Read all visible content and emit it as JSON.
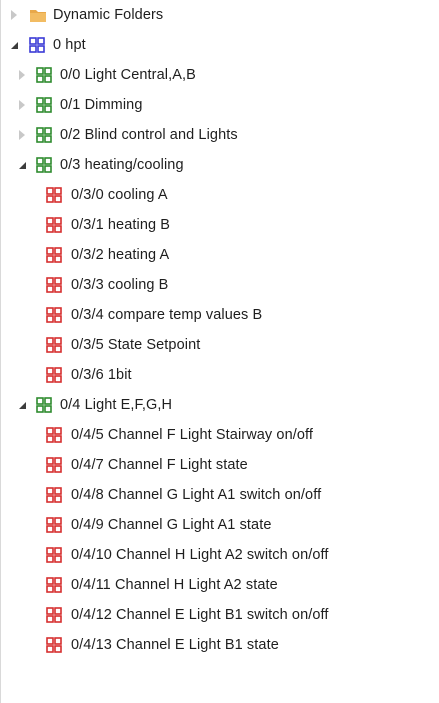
{
  "colors": {
    "folder": "#e8a84a",
    "root_group": "#3a3ad6",
    "middle_group": "#2e8b2e",
    "group_address": "#d62f2f",
    "expander_collapsed": "#c8c8c8",
    "expander_expanded": "#3c3c3c"
  },
  "tree": {
    "dynamic_folders": {
      "label": "Dynamic Folders",
      "icon": "folder-icon",
      "state": "collapsed"
    },
    "root": {
      "label": "0 hpt",
      "icon": "main-group-icon",
      "state": "expanded"
    },
    "groups": [
      {
        "label": "0/0 Light Central,A,B",
        "state": "collapsed"
      },
      {
        "label": "0/1 Dimming",
        "state": "collapsed"
      },
      {
        "label": "0/2 Blind control and Lights",
        "state": "collapsed"
      },
      {
        "label": "0/3 heating/cooling",
        "state": "expanded",
        "addresses": [
          "0/3/0 cooling A",
          "0/3/1 heating B",
          "0/3/2 heating A",
          "0/3/3 cooling B",
          "0/3/4 compare temp values B",
          "0/3/5 State Setpoint",
          "0/3/6 1bit"
        ]
      },
      {
        "label": "0/4 Light E,F,G,H",
        "state": "expanded",
        "addresses": [
          "0/4/5 Channel F Light Stairway on/off",
          "0/4/7 Channel F Light state",
          "0/4/8 Channel G Light A1 switch on/off",
          "0/4/9 Channel G Light A1 state",
          "0/4/10 Channel H Light A2 switch on/off",
          "0/4/11 Channel H Light A2 state",
          "0/4/12 Channel E Light B1 switch on/off",
          "0/4/13 Channel E Light B1 state"
        ]
      }
    ]
  }
}
